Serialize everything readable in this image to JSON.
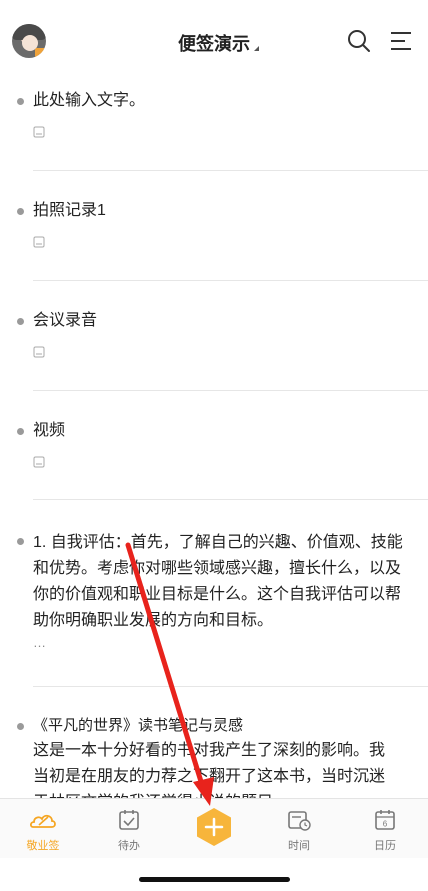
{
  "header": {
    "title": "便签演示"
  },
  "notes": [
    {
      "text": "此处输入文字。"
    },
    {
      "text": "拍照记录1"
    },
    {
      "text": "会议录音"
    },
    {
      "text": "视频"
    },
    {
      "text": "1. 自我评估：首先，了解自己的兴趣、价值观、技能和优势。考虑你对哪些领域感兴趣，擅长什么，以及你的价值观和职业目标是什么。这个自我评估可以帮助你明确职业发展的方向和目标。",
      "ellipsis": "…"
    },
    {
      "title": "《平凡的世界》读书笔记与灵感",
      "line1": "这是一本十分好看的书对我产生了深刻的影响。我",
      "line2": "当初是在朋友的力荐之下翻开了这本书，当时沉迷",
      "line3": "于林区文学的我还觉得小说的题目"
    }
  ],
  "tabbar": {
    "items": [
      {
        "label": "敬业签",
        "icon": "cloud-pen-icon",
        "active": true
      },
      {
        "label": "待办",
        "icon": "todo-check-icon",
        "active": false
      },
      {
        "label": "时间",
        "icon": "calendar-clock-icon",
        "active": false
      },
      {
        "label": "日历",
        "icon": "calendar-icon",
        "active": false
      }
    ],
    "calendar_day": "6",
    "add_icon": "plus-icon"
  },
  "colors": {
    "accent": "#f5a623",
    "arrow": "#e8231c"
  }
}
